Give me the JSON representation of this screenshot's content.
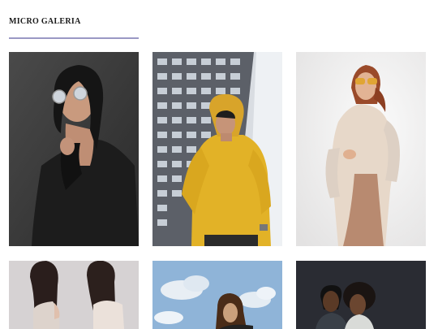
{
  "gallery": {
    "title": "MICRO GALERIA",
    "accent_color": "#9a98c4",
    "photos": [
      {
        "alt": "woman-round-sunglasses-black-coat"
      },
      {
        "alt": "man-yellow-hoodie-glass-building"
      },
      {
        "alt": "woman-amber-sunglasses-beige-outfit"
      },
      {
        "alt": "two-women-back-to-back"
      },
      {
        "alt": "woman-blue-sky-clouds"
      },
      {
        "alt": "couple-dark-background"
      }
    ]
  }
}
